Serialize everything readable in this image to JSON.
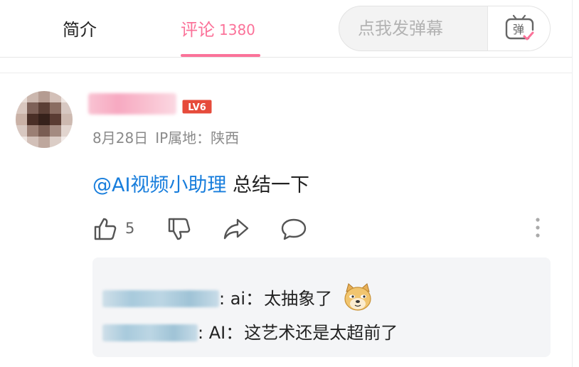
{
  "tabs": {
    "intro": "简介",
    "comments": "评论",
    "comments_count": "1380"
  },
  "danmaku": {
    "placeholder": "点我发弹幕",
    "button_icon": "danmaku-icon",
    "button_label": "弹"
  },
  "comment": {
    "level_badge": "LV6",
    "date": "8月28日",
    "ip": "IP属地：陕西",
    "mention": "@AI视频小助理",
    "text": " 总结一下",
    "like_count": "5",
    "icons": [
      "thumbs-up-icon",
      "thumbs-down-icon",
      "share-icon",
      "reply-icon",
      "more-vertical-icon"
    ]
  },
  "replies": [
    {
      "separator": ": ai：",
      "text": "太抽象了",
      "emoji": "doge-emoji"
    },
    {
      "separator": ": AI：",
      "text": "这艺术还是太超前了"
    }
  ],
  "colors": {
    "accent_pink": "#fb7299",
    "mention_blue": "#177ddc",
    "level_red": "#e64b3b"
  }
}
